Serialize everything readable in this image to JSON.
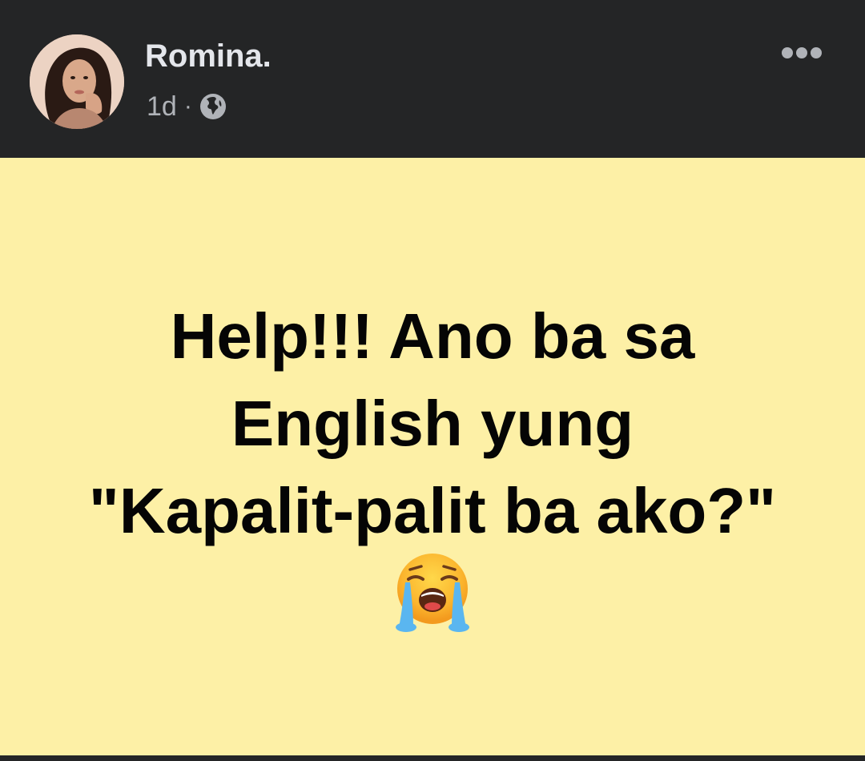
{
  "author": {
    "name": "Romina."
  },
  "meta": {
    "time": "1d",
    "separator": "·",
    "audience_icon": "globe-icon"
  },
  "more_icon": "more-horizontal-icon",
  "post": {
    "lines": [
      "Help!!! Ano ba sa",
      "English yung",
      "\"Kapalit-palit ba ako?\""
    ],
    "emoji_icon": "loudly-crying-face-emoji",
    "background_color": "#fdf0a6",
    "text_color": "#050505"
  },
  "theme": {
    "header_bg": "#242526",
    "name_color": "#e4e6eb",
    "meta_color": "#b0b3b8"
  }
}
